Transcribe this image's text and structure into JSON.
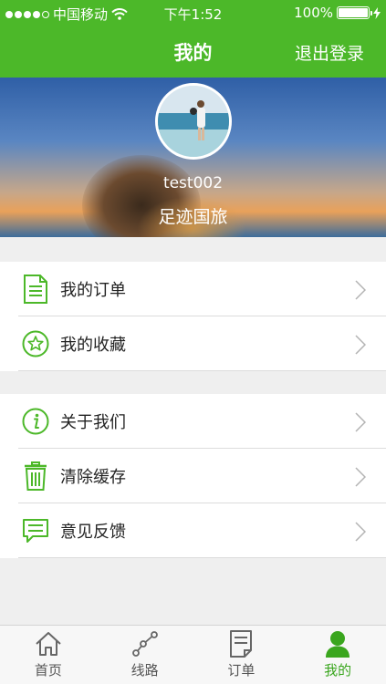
{
  "status_bar": {
    "carrier": "中国移动",
    "time": "下午1:52",
    "battery": "100%"
  },
  "nav": {
    "title": "我的",
    "logout": "退出登录"
  },
  "profile": {
    "username": "test002",
    "brand": "足迹国旅"
  },
  "group1": [
    {
      "label": "我的订单",
      "icon": "document-icon"
    },
    {
      "label": "我的收藏",
      "icon": "star-icon"
    }
  ],
  "group2": [
    {
      "label": "关于我们",
      "icon": "info-icon"
    },
    {
      "label": "清除缓存",
      "icon": "trash-icon"
    },
    {
      "label": "意见反馈",
      "icon": "feedback-icon"
    }
  ],
  "tabs": [
    {
      "label": "首页",
      "icon": "home-icon"
    },
    {
      "label": "线路",
      "icon": "route-icon"
    },
    {
      "label": "订单",
      "icon": "order-icon"
    },
    {
      "label": "我的",
      "icon": "user-icon",
      "active": true
    }
  ],
  "colors": {
    "accent": "#4cb829",
    "tab_active": "#3aa61e"
  }
}
